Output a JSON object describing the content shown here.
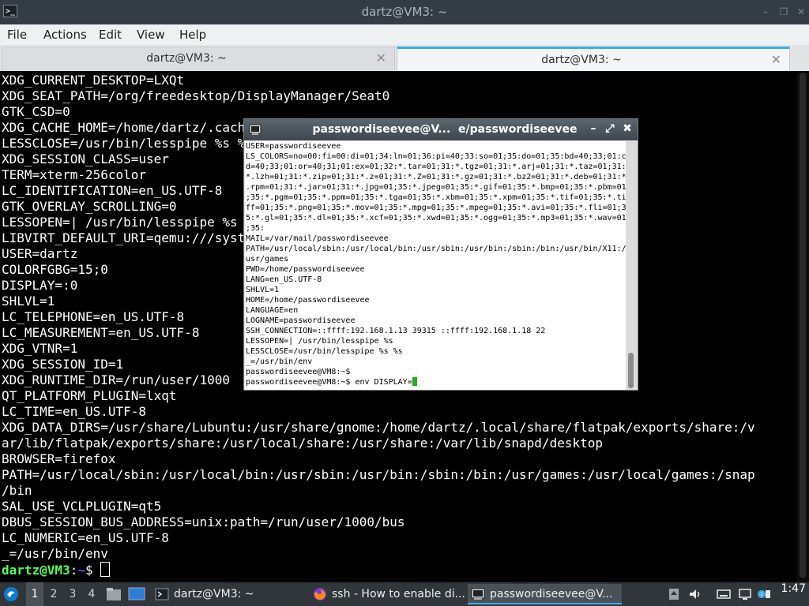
{
  "window": {
    "title": "dartz@VM3: ~",
    "app_icon_glyph": ">_",
    "minimize": "–",
    "maximize": "❒",
    "close": "✕"
  },
  "menubar": [
    "File",
    "Actions",
    "Edit",
    "View",
    "Help"
  ],
  "tabs": [
    {
      "label": "dartz@VM3: ~",
      "active": false
    },
    {
      "label": "dartz@VM3: ~",
      "active": true
    }
  ],
  "terminal": {
    "lines": [
      "XDG_CURRENT_DESKTOP=LXQt",
      "XDG_SEAT_PATH=/org/freedesktop/DisplayManager/Seat0",
      "GTK_CSD=0",
      "XDG_CACHE_HOME=/home/dartz/.cache",
      "LESSCLOSE=/usr/bin/lesspipe %s %s",
      "XDG_SESSION_CLASS=user",
      "TERM=xterm-256color",
      "LC_IDENTIFICATION=en_US.UTF-8",
      "GTK_OVERLAY_SCROLLING=0",
      "LESSOPEN=| /usr/bin/lesspipe %s",
      "LIBVIRT_DEFAULT_URI=qemu:///system",
      "USER=dartz",
      "COLORFGBG=15;0",
      "DISPLAY=:0",
      "SHLVL=1",
      "LC_TELEPHONE=en_US.UTF-8",
      "LC_MEASUREMENT=en_US.UTF-8",
      "XDG_VTNR=1",
      "XDG_SESSION_ID=1",
      "XDG_RUNTIME_DIR=/run/user/1000",
      "QT_PLATFORM_PLUGIN=lxqt",
      "LC_TIME=en_US.UTF-8",
      "XDG_DATA_DIRS=/usr/share/Lubuntu:/usr/share/gnome:/home/dartz/.local/share/flatpak/exports/share:/v",
      "ar/lib/flatpak/exports/share:/usr/local/share:/usr/share:/var/lib/snapd/desktop",
      "BROWSER=firefox",
      "PATH=/usr/local/sbin:/usr/local/bin:/usr/sbin:/usr/bin:/sbin:/bin:/usr/games:/usr/local/games:/snap",
      "/bin",
      "SAL_USE_VCLPLUGIN=qt5",
      "DBUS_SESSION_BUS_ADDRESS=unix:path=/run/user/1000/bus",
      "LC_NUMERIC=en_US.UTF-8",
      "_=/usr/bin/env"
    ],
    "prompt_user": "dartz@VM3",
    "prompt_sep": ":",
    "prompt_path": "~",
    "prompt_end": "$ "
  },
  "xterm": {
    "title": "passwordiseevee@V...  e/passwordiseevee",
    "minimize": "–",
    "maximize": "⤢",
    "close": "✖",
    "lines": [
      "USER=passwordiseevee",
      "LS_COLORS=no=00:fi=00:di=01;34:ln=01;36:pi=40;33:so=01;35:do=01;35:bd=40;33;01:c",
      "d=40;33;01:or=40;31;01:ex=01;32:*.tar=01;31:*.tgz=01;31:*.arj=01;31:*.taz=01;31:",
      "*.lzh=01;31:*.zip=01;31:*.z=01;31:*.Z=01;31:*.gz=01;31:*.bz2=01;31:*.deb=01;31:*",
      ".rpm=01;31:*.jar=01;31:*.jpg=01;35:*.jpeg=01;35:*.gif=01;35:*.bmp=01;35:*.pbm=01",
      ";35:*.pgm=01;35:*.ppm=01;35:*.tga=01;35:*.xbm=01;35:*.xpm=01;35:*.tif=01;35:*.ti",
      "ff=01;35:*.png=01;35:*.mov=01;35:*.mpg=01;35:*.mpeg=01;35:*.avi=01;35:*.fli=01;3",
      "5:*.gl=01;35:*.dl=01;35:*.xcf=01;35:*.xwd=01;35:*.ogg=01;35:*.mp3=01;35:*.wav=01",
      ";35:",
      "MAIL=/var/mail/passwordiseevee",
      "PATH=/usr/local/sbin:/usr/local/bin:/usr/sbin:/usr/bin:/sbin:/bin:/usr/bin/X11:/",
      "usr/games",
      "PWD=/home/passwordiseevee",
      "LANG=en_US.UTF-8",
      "SHLVL=1",
      "HOME=/home/passwordiseevee",
      "LANGUAGE=en",
      "LOGNAME=passwordiseevee",
      "SSH_CONNECTION=::ffff:192.168.1.13 39315 ::ffff:192.168.1.18 22",
      "LESSOPEN=| /usr/bin/lesspipe %s",
      "LESSCLOSE=/usr/bin/lesspipe %s %s",
      "_=/usr/bin/env",
      "passwordiseevee@VM8:~$"
    ],
    "input_line": "passwordiseevee@VM8:~$ env DISPLAY="
  },
  "taskbar": {
    "workspaces": [
      "1",
      "2",
      "3",
      "4"
    ],
    "tasks": [
      {
        "label": "dartz@VM3: ~",
        "icon": "terminal-icon",
        "active": false
      },
      {
        "label": "ssh - How to enable di...",
        "icon": "firefox-icon",
        "active": false
      },
      {
        "label": "passwordiseevee@V...",
        "icon": "xterm-icon",
        "active": true
      }
    ],
    "clock": "1:47"
  },
  "colors": {
    "prompt_user": "#55ff55",
    "prompt_path": "#5555ff",
    "accent": "#3daee9",
    "xterm_cursor": "#22aa22"
  }
}
